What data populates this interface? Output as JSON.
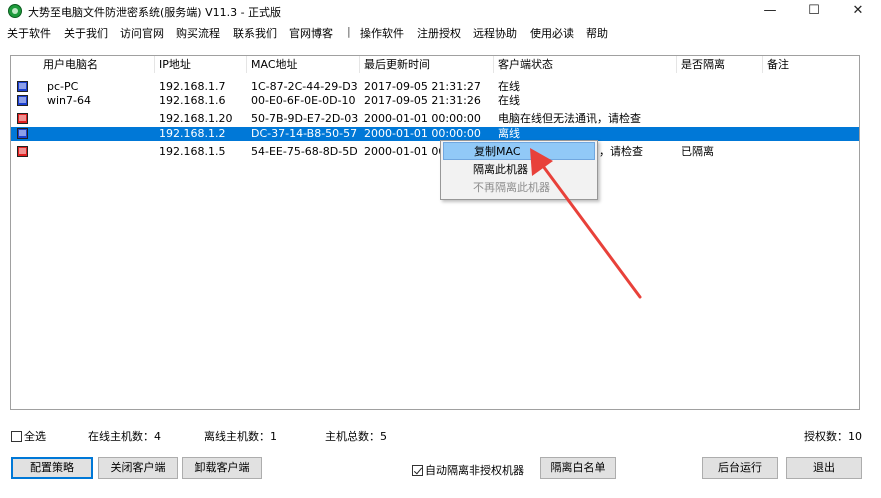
{
  "window": {
    "title": "大势至电脑文件防泄密系统(服务端) V11.3 - 正式版",
    "minimize": "—",
    "maximize": "☐",
    "close": "✕"
  },
  "menu": {
    "items": [
      "关于软件",
      "关于我们",
      "访问官网",
      "购买流程",
      "联系我们",
      "官网博客",
      "|",
      "操作软件",
      "注册授权",
      "远程协助",
      "使用必读",
      "帮助"
    ]
  },
  "table": {
    "headers": [
      "用户电脑名",
      "IP地址",
      "MAC地址",
      "最后更新时间",
      "客户端状态",
      "是否隔离",
      "备注"
    ],
    "rows": [
      {
        "name": "pc-PC",
        "ip": "192.168.1.7",
        "mac": "1C-87-2C-44-29-D3",
        "time": "2017-09-05 21:31:27",
        "status": "在线",
        "isolated": "",
        "note": "",
        "icon_color": "#1a3fd0"
      },
      {
        "name": "win7-64",
        "ip": "192.168.1.6",
        "mac": "00-E0-6F-0E-0D-10",
        "time": "2017-09-05 21:31:26",
        "status": "在线",
        "isolated": "",
        "note": "",
        "icon_color": "#1a3fd0"
      },
      {
        "name": "",
        "ip": "192.168.1.20",
        "mac": "50-7B-9D-E7-2D-03",
        "time": "2000-01-01 00:00:00",
        "status": "电脑在线但无法通讯，请检查",
        "isolated": "",
        "note": "",
        "icon_color": "#e02020"
      },
      {
        "name": "",
        "ip": "192.168.1.2",
        "mac": "DC-37-14-B8-50-57",
        "time": "2000-01-01 00:00:00",
        "status": "离线",
        "isolated": "",
        "note": "",
        "icon_color": "#1a3fd0"
      },
      {
        "name": "",
        "ip": "192.168.1.5",
        "mac": "54-EE-75-68-8D-5D",
        "time": "2000-01-01 00",
        "status": "，请检查",
        "isolated": "已隔离",
        "note": "",
        "icon_color": "#e02020"
      }
    ],
    "selected_row": 3
  },
  "context_menu": {
    "items": [
      "复制MAC",
      "隔离此机器",
      "不再隔离此机器"
    ]
  },
  "status": {
    "select_all": "全选",
    "online": "在线主机数：4",
    "offline": "离线主机数：1",
    "total": "主机总数：5",
    "licenses": "授权数：10"
  },
  "buttons": {
    "config": "配置策略",
    "close_client": "关闭客户端",
    "uninstall_client": "卸载客户端",
    "auto_isolate": "自动隔离非授权机器",
    "whitelist": "隔离白名单",
    "background": "后台运行",
    "exit": "退出"
  },
  "colors": {
    "selection": "#0078d7",
    "arrow": "#e8413a"
  }
}
